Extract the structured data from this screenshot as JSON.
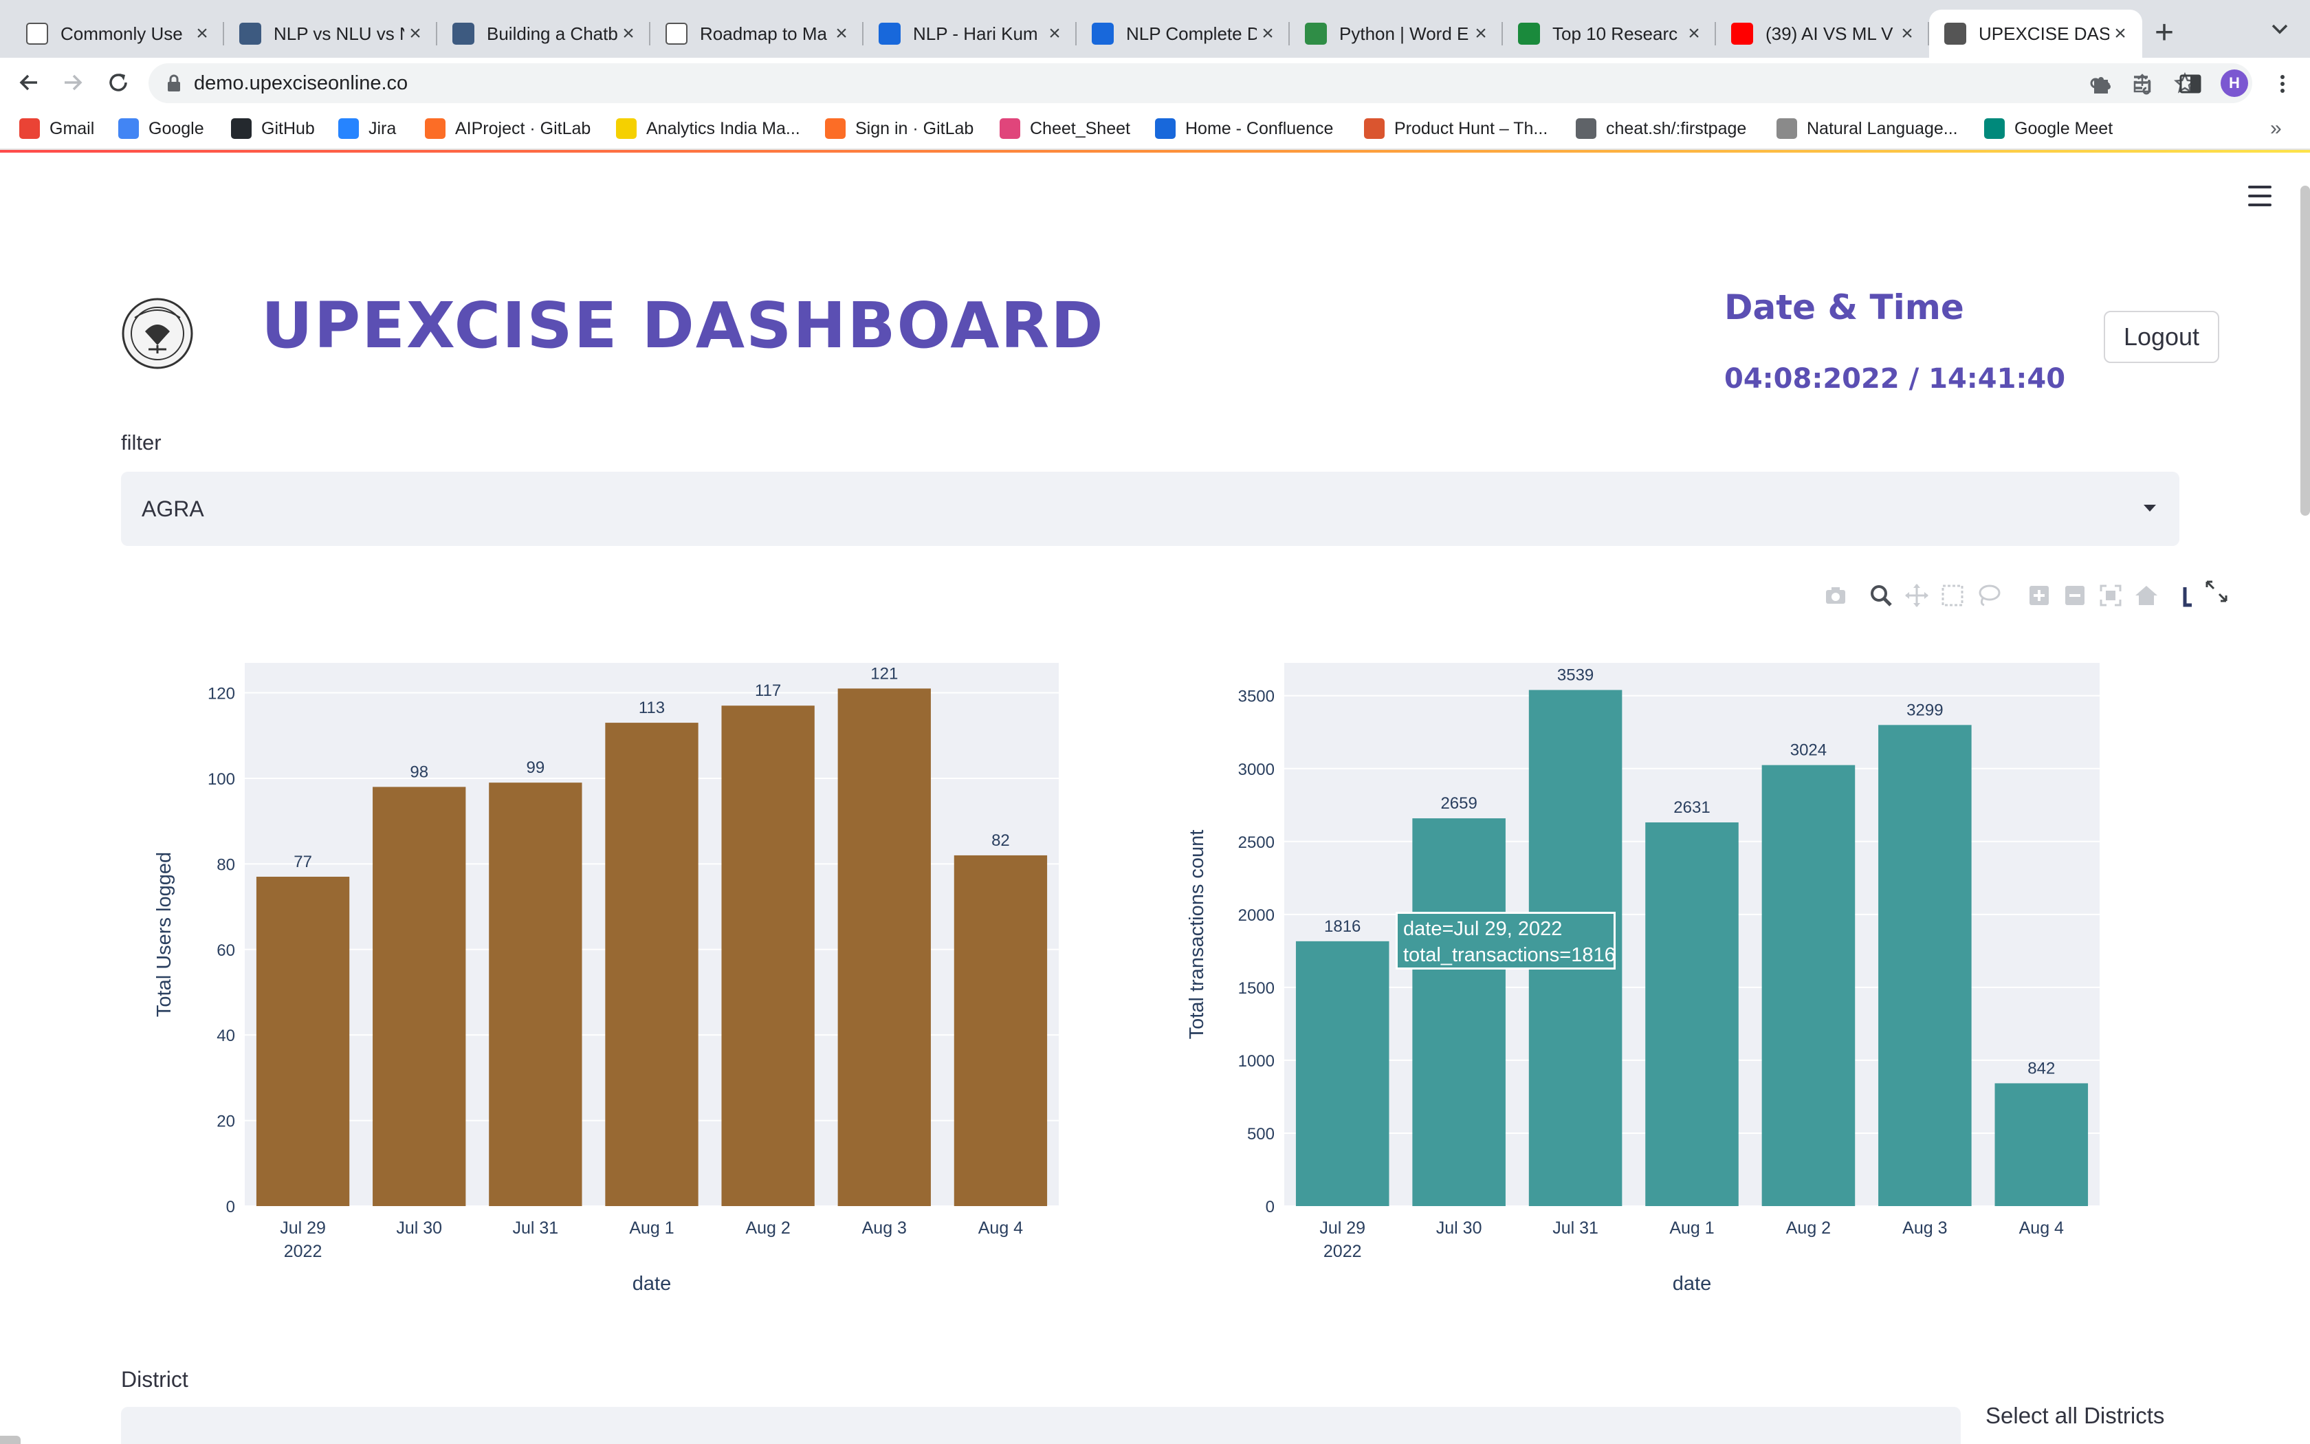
{
  "browser": {
    "tabs": [
      {
        "title": "Commonly Use",
        "favicon": "chart-line-icon",
        "color": "#ffffff"
      },
      {
        "title": "NLP vs NLU vs N",
        "favicon": "tds-icon",
        "color": "#3d5a80"
      },
      {
        "title": "Building a Chatb",
        "favicon": "tds-icon",
        "color": "#3d5a80"
      },
      {
        "title": "Roadmap to Ma",
        "favicon": "chart-line-icon",
        "color": "#ffffff"
      },
      {
        "title": "NLP - Hari Kum",
        "favicon": "confluence-icon",
        "color": "#1868db"
      },
      {
        "title": "NLP Complete D",
        "favicon": "confluence-icon",
        "color": "#1868db"
      },
      {
        "title": "Python | Word E",
        "favicon": "gfg-icon",
        "color": "#2f8d46"
      },
      {
        "title": "Top 10 Researc",
        "favicon": "dots-icon",
        "color": "#1a8a3c"
      },
      {
        "title": "(39) AI VS ML V",
        "favicon": "youtube-icon",
        "color": "#ff0000"
      },
      {
        "title": "UPEXCISE DASH",
        "favicon": "emblem-icon",
        "color": "#555555",
        "active": true
      }
    ],
    "url": "demo.upexciseonline.co",
    "profile_initial": "H",
    "bookmarks": [
      {
        "label": "Gmail",
        "icon": "gmail-icon",
        "color": "#ea4335"
      },
      {
        "label": "Google",
        "icon": "google-icon",
        "color": "#4285f4"
      },
      {
        "label": "GitHub",
        "icon": "github-icon",
        "color": "#24292e"
      },
      {
        "label": "Jira",
        "icon": "jira-icon",
        "color": "#2684ff"
      },
      {
        "label": "AIProject · GitLab",
        "icon": "gitlab-icon",
        "color": "#fc6d26"
      },
      {
        "label": "Analytics India Ma...",
        "icon": "aim-icon",
        "color": "#f5d000"
      },
      {
        "label": "Sign in · GitLab",
        "icon": "gitlab-icon",
        "color": "#fc6d26"
      },
      {
        "label": "Cheet_Sheet",
        "icon": "cheatsheet-icon",
        "color": "#e0457b"
      },
      {
        "label": "Home - Confluence",
        "icon": "confluence-icon",
        "color": "#1868db"
      },
      {
        "label": "Product Hunt – Th...",
        "icon": "producthunt-icon",
        "color": "#da552f"
      },
      {
        "label": "cheat.sh/:firstpage",
        "icon": "globe-icon",
        "color": "#5f6368"
      },
      {
        "label": "Natural Language...",
        "icon": "chart-line-icon",
        "color": "#8a8a8a"
      },
      {
        "label": "Google Meet",
        "icon": "meet-icon",
        "color": "#00897b"
      }
    ]
  },
  "header": {
    "title": "UPEXCISE DASHBOARD",
    "datetime_label": "Date & Time",
    "datetime_value": "04:08:2022 / 14:41:40",
    "logout_label": "Logout"
  },
  "filter": {
    "label": "filter",
    "selected": "AGRA"
  },
  "district": {
    "label": "District",
    "select_all_label": "Select all Districts"
  },
  "tooltip": {
    "line1": "date=Jul 29, 2022",
    "line2": "total_transactions=1816"
  },
  "chart_data": [
    {
      "type": "bar",
      "categories": [
        "Jul 29",
        "Jul 30",
        "Jul 31",
        "Aug 1",
        "Aug 2",
        "Aug 3",
        "Aug 4"
      ],
      "category_sublabels": [
        "2022",
        "",
        "",
        "",
        "",
        "",
        ""
      ],
      "values": [
        77,
        98,
        99,
        113,
        117,
        121,
        82
      ],
      "xlabel": "date",
      "ylabel": "Total Users logged",
      "ylim": [
        0,
        127
      ],
      "yticks": [
        0,
        20,
        40,
        60,
        80,
        100,
        120
      ],
      "color": "#986933",
      "grid": true
    },
    {
      "type": "bar",
      "categories": [
        "Jul 29",
        "Jul 30",
        "Jul 31",
        "Aug 1",
        "Aug 2",
        "Aug 3",
        "Aug 4"
      ],
      "category_sublabels": [
        "2022",
        "",
        "",
        "",
        "",
        "",
        ""
      ],
      "values": [
        1816,
        2659,
        3539,
        2631,
        3024,
        3299,
        842
      ],
      "xlabel": "date",
      "ylabel": "Total transactions count",
      "ylim": [
        0,
        3725
      ],
      "yticks": [
        0,
        500,
        1000,
        1500,
        2000,
        2500,
        3000,
        3500
      ],
      "color": "#429a9a",
      "grid": true
    }
  ]
}
